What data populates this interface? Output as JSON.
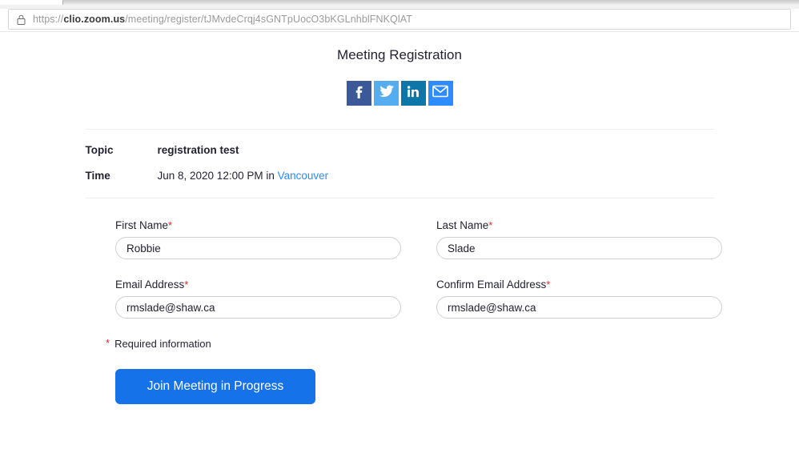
{
  "browser": {
    "lock_icon": "lock-icon",
    "url_scheme": "https://",
    "url_host_bold": "clio.zoom.us",
    "url_path": "/meeting/register/tJMvdeCrqj4sGNTpUocO3bKGLnhblFNKQlAT",
    "url_full": "https://clio.zoom.us/meeting/register/tJMvdeCrqj4sGNTpUocO3bKGLnhblFNKQlAT"
  },
  "page": {
    "title": "Meeting Registration"
  },
  "share": {
    "items": [
      {
        "name": "facebook",
        "label": "f",
        "color": "#3b5998"
      },
      {
        "name": "twitter",
        "label": "Twitter",
        "color": "#55acee"
      },
      {
        "name": "linkedin",
        "label": "in",
        "color": "#0e76a8"
      },
      {
        "name": "email",
        "label": "Email",
        "color": "#2d8cff"
      }
    ]
  },
  "info": {
    "topic_label": "Topic",
    "topic_value": "registration test",
    "time_label": "Time",
    "time_value": "Jun 8, 2020 12:00 PM in ",
    "time_timezone": "Vancouver"
  },
  "form": {
    "first_name": {
      "label": "First Name",
      "required_marker": "*",
      "value": "Robbie",
      "placeholder": ""
    },
    "last_name": {
      "label": "Last Name",
      "required_marker": "*",
      "value": "Slade",
      "placeholder": ""
    },
    "email": {
      "label": "Email Address",
      "required_marker": "*",
      "value": "rmslade@shaw.ca",
      "placeholder": ""
    },
    "confirm_email": {
      "label": "Confirm Email Address",
      "required_marker": "*",
      "value": "rmslade@shaw.ca",
      "placeholder": ""
    },
    "required_note_star": "*",
    "required_note": "Required information",
    "submit_label": "Join Meeting in Progress"
  },
  "colors": {
    "accent_blue": "#2d8cff",
    "button_blue": "#1572e8",
    "required_red": "#e02828",
    "text": "#232333",
    "divider": "#ededf2"
  }
}
